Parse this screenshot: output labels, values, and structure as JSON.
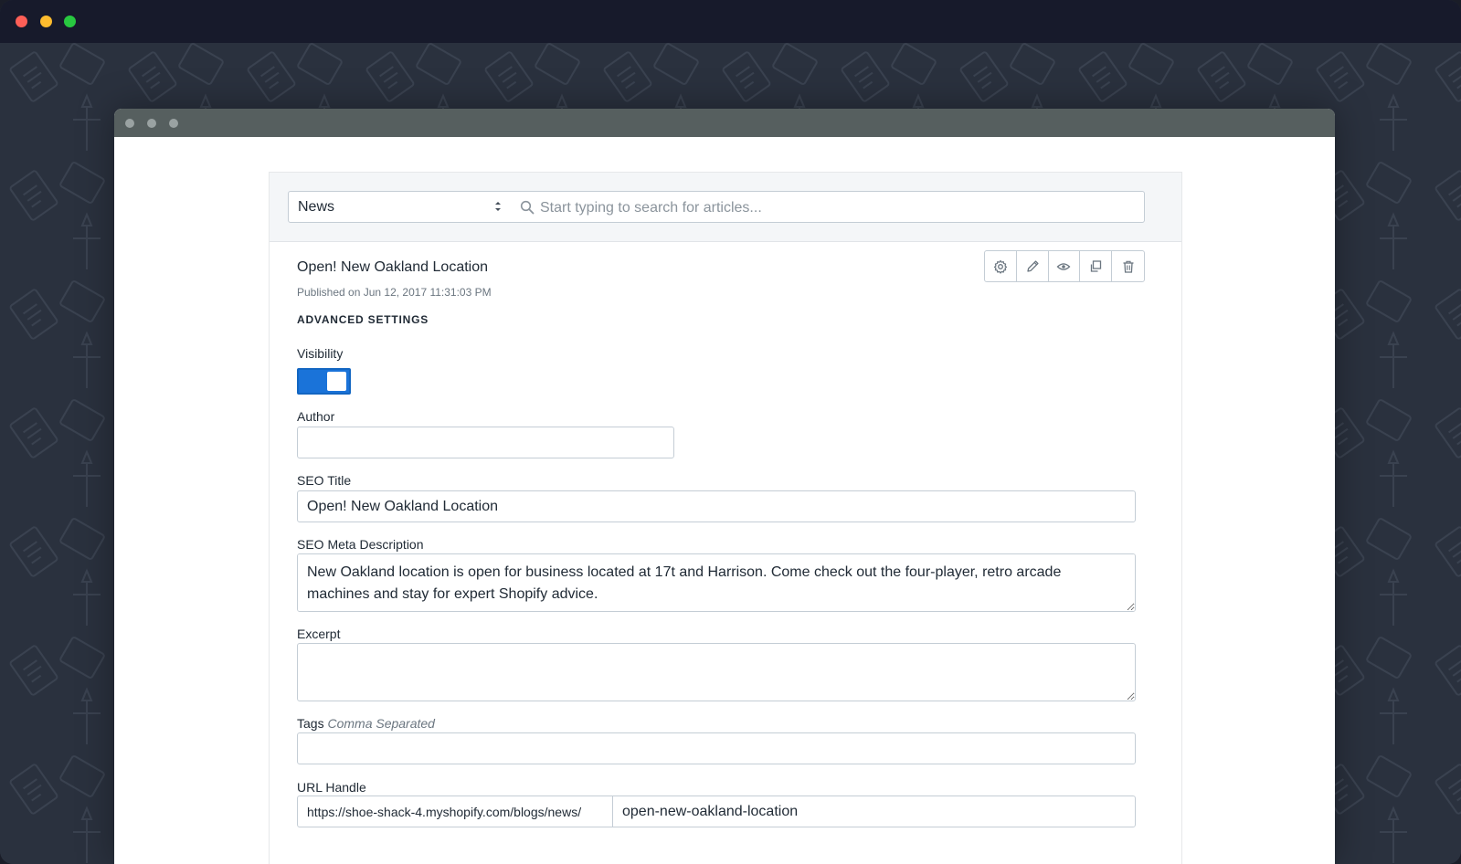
{
  "blog_selector": {
    "value": "News"
  },
  "search": {
    "placeholder": "Start typing to search for articles..."
  },
  "article": {
    "title": "Open! New Oakland Location",
    "meta": "Published on Jun 12, 2017 11:31:03 PM"
  },
  "section": {
    "heading": "ADVANCED SETTINGS"
  },
  "toolbar": {
    "icons": [
      "gear-icon",
      "pencil-icon",
      "eye-icon",
      "duplicate-icon",
      "trash-icon"
    ]
  },
  "fields": {
    "visibility": {
      "label": "Visibility",
      "on": true
    },
    "author": {
      "label": "Author",
      "value": ""
    },
    "seo_title": {
      "label": "SEO Title",
      "value": "Open! New Oakland Location"
    },
    "seo_description": {
      "label": "SEO Meta Description",
      "value": "New Oakland location is open for business located at 17t and Harrison. Come check out the four-player, retro arcade machines and stay for expert Shopify advice."
    },
    "excerpt": {
      "label": "Excerpt",
      "value": ""
    },
    "tags": {
      "label": "Tags",
      "hint": "Comma Separated",
      "value": ""
    },
    "url_handle": {
      "label": "URL Handle",
      "prefix": "https://shoe-shack-4.myshopify.com/blogs/news/",
      "value": "open-new-oakland-location"
    }
  },
  "colors": {
    "toggle_on": "#1a73d9",
    "titlebar": "#171a2b",
    "background": "#2a313e"
  }
}
